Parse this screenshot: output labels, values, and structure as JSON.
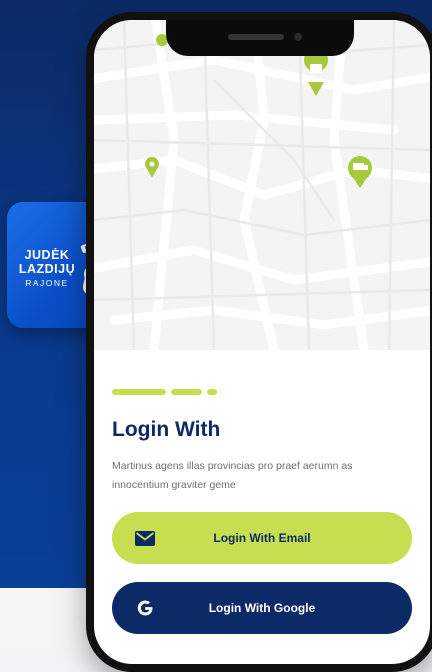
{
  "colors": {
    "navy": "#0b2a66",
    "accent": "#c6de4f",
    "brand_blue": "#0a4fc8"
  },
  "app_icon": {
    "line1": "JUDĖK",
    "line2": "LAZDIJŲ",
    "line3": "RAJONE"
  },
  "map_pins": [
    "store-pin-icon",
    "location-pin-icon",
    "truck-pin-icon",
    "location-pin-icon"
  ],
  "login": {
    "title": "Login With",
    "description": "Martinus agens illas provincias pro praef aerumn as innocentium graviter geme",
    "email_button": {
      "label": "Login With Email",
      "icon": "mail-icon"
    },
    "google_button": {
      "label": "Login With Google",
      "icon": "google-icon"
    }
  },
  "pager": {
    "count": 3,
    "active": 0
  }
}
